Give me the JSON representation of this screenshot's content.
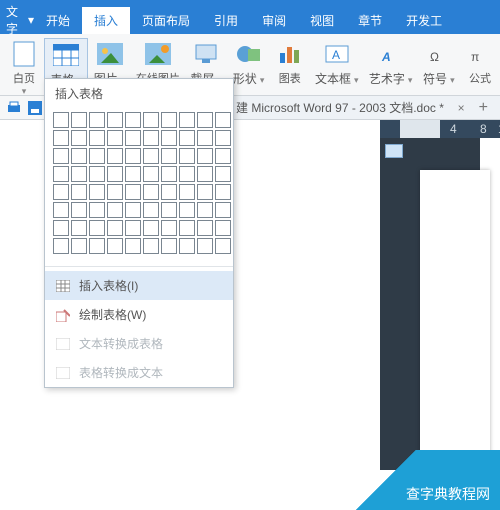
{
  "tabs": {
    "file": "文字",
    "home": "开始",
    "insert": "插入",
    "layout": "页面布局",
    "ref": "引用",
    "review": "审阅",
    "view": "视图",
    "chapter": "章节",
    "dev": "开发工"
  },
  "ribbon": {
    "blank": "白页",
    "table": "表格",
    "image": "图片",
    "online": "在线图片",
    "screenshot": "截屏",
    "shape": "形状",
    "chart": "图表",
    "textbox": "文本框",
    "wordart": "艺术字",
    "symbol": "符号",
    "formula": "公式"
  },
  "doc": {
    "prefix": "建",
    "name": "Microsoft Word 97 - 2003 文档.doc *"
  },
  "ruler": {
    "n4": "4",
    "n8": "8",
    "n1": "1"
  },
  "menu": {
    "title": "插入表格",
    "insert": "插入表格(I)",
    "draw": "绘制表格(W)",
    "texttotable": "文本转换成表格",
    "tabletotext": "表格转换成文本"
  },
  "watermark": "查字典教程网"
}
